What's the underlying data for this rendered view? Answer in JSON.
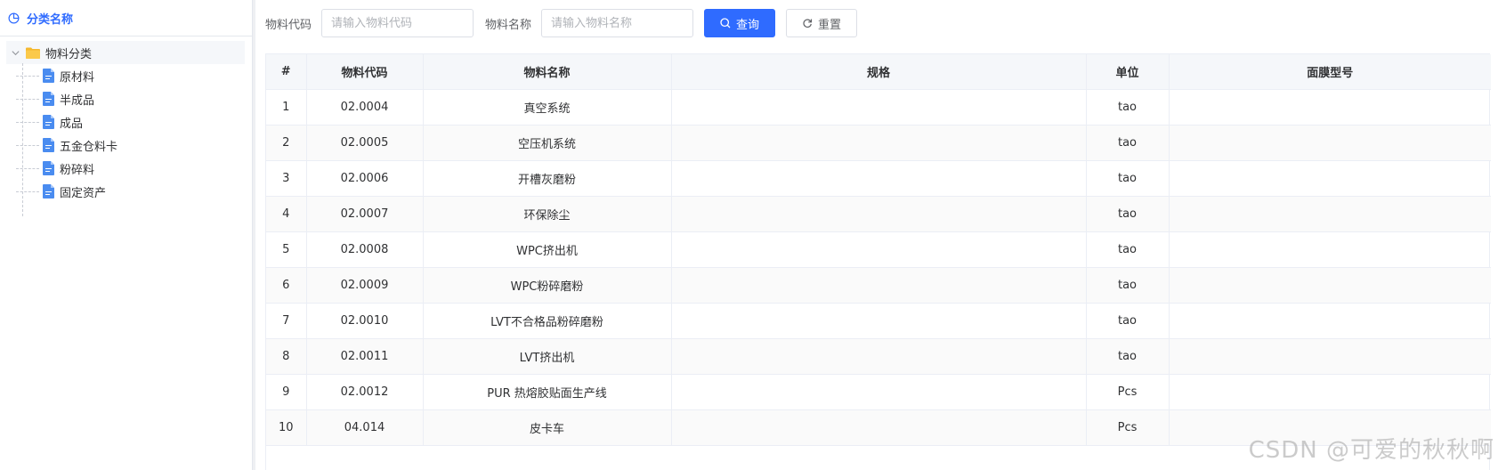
{
  "sidebar": {
    "title": "分类名称",
    "root": {
      "label": "物料分类"
    },
    "items": [
      {
        "label": "原材料"
      },
      {
        "label": "半成品"
      },
      {
        "label": "成品"
      },
      {
        "label": "五金仓料卡"
      },
      {
        "label": "粉碎料"
      },
      {
        "label": "固定资产"
      }
    ]
  },
  "filters": {
    "code_label": "物料代码",
    "code_placeholder": "请输入物料代码",
    "name_label": "物料名称",
    "name_placeholder": "请输入物料名称",
    "search_label": "查询",
    "reset_label": "重置"
  },
  "table": {
    "columns": [
      "#",
      "物料代码",
      "物料名称",
      "规格",
      "单位",
      "面膜型号"
    ],
    "rows": [
      {
        "no": "1",
        "code": "02.0004",
        "name": "真空系统",
        "spec": "",
        "unit": "tao",
        "model": ""
      },
      {
        "no": "2",
        "code": "02.0005",
        "name": "空压机系统",
        "spec": "",
        "unit": "tao",
        "model": ""
      },
      {
        "no": "3",
        "code": "02.0006",
        "name": "开槽灰磨粉",
        "spec": "",
        "unit": "tao",
        "model": ""
      },
      {
        "no": "4",
        "code": "02.0007",
        "name": "环保除尘",
        "spec": "",
        "unit": "tao",
        "model": ""
      },
      {
        "no": "5",
        "code": "02.0008",
        "name": "WPC挤出机",
        "spec": "",
        "unit": "tao",
        "model": ""
      },
      {
        "no": "6",
        "code": "02.0009",
        "name": "WPC粉碎磨粉",
        "spec": "",
        "unit": "tao",
        "model": ""
      },
      {
        "no": "7",
        "code": "02.0010",
        "name": "LVT不合格品粉碎磨粉",
        "spec": "",
        "unit": "tao",
        "model": ""
      },
      {
        "no": "8",
        "code": "02.0011",
        "name": "LVT挤出机",
        "spec": "",
        "unit": "tao",
        "model": ""
      },
      {
        "no": "9",
        "code": "02.0012",
        "name": "PUR 热熔胶贴面生产线",
        "spec": "",
        "unit": "Pcs",
        "model": ""
      },
      {
        "no": "10",
        "code": "04.014",
        "name": "皮卡车",
        "spec": "",
        "unit": "Pcs",
        "model": ""
      }
    ]
  },
  "watermark": "CSDN @可爱的秋秋啊",
  "colors": {
    "primary": "#2f6bff",
    "folder": "#f5b82e",
    "file": "#4a8cf0"
  }
}
